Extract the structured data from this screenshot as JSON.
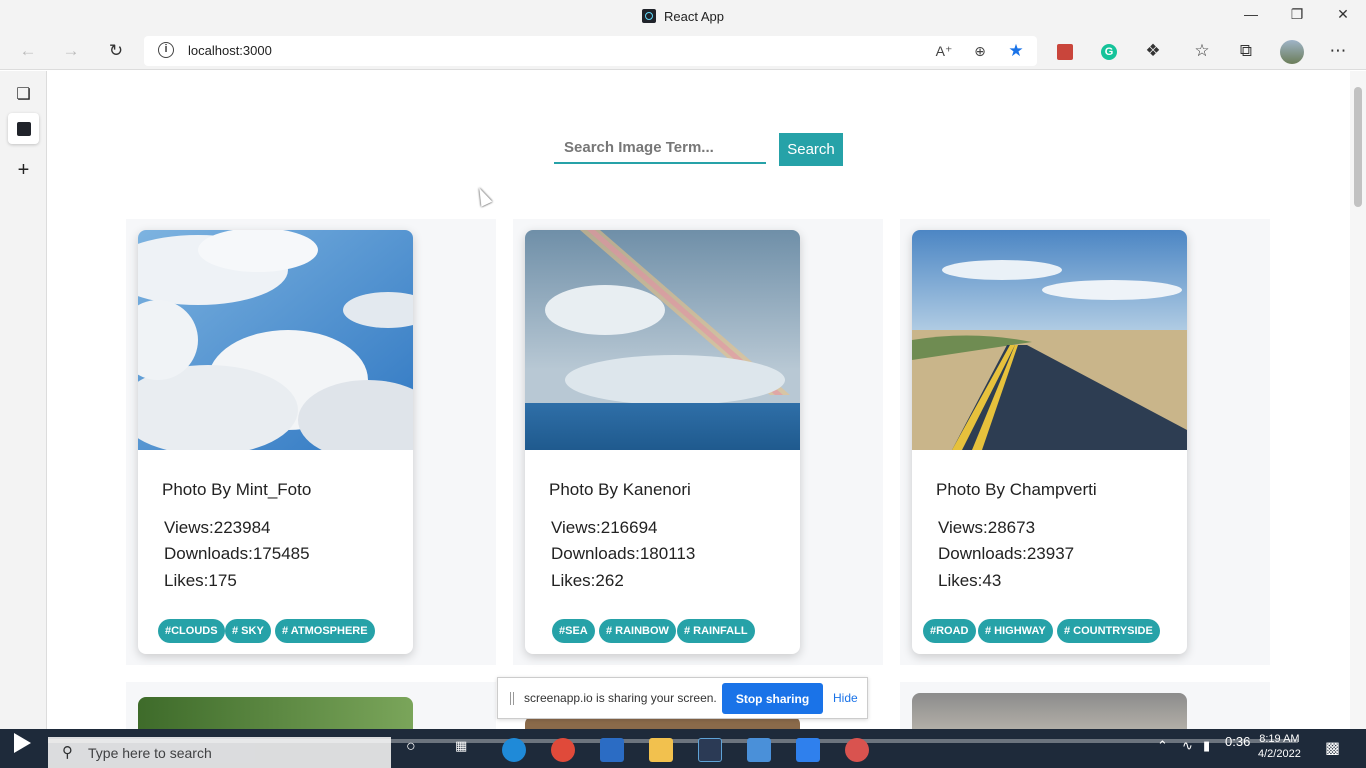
{
  "window": {
    "title": "React App"
  },
  "toolbar": {
    "url": "localhost:3000"
  },
  "search": {
    "placeholder": "Search Image Term...",
    "button_label": "Search"
  },
  "cards": [
    {
      "author": "Photo By Mint_Foto",
      "views_label": "Views:",
      "views": "223984",
      "downloads_label": "Downloads:",
      "downloads": "175485",
      "likes_label": "Likes:",
      "likes": "175",
      "tags": [
        "#CLOUDS",
        "# SKY",
        "# ATMOSPHERE"
      ]
    },
    {
      "author": "Photo By Kanenori",
      "views_label": "Views:",
      "views": "216694",
      "downloads_label": "Downloads:",
      "downloads": "180113",
      "likes_label": "Likes:",
      "likes": "262",
      "tags": [
        "#SEA",
        "# RAINBOW",
        "# RAINFALL"
      ]
    },
    {
      "author": "Photo By Champverti",
      "views_label": "Views:",
      "views": "28673",
      "downloads_label": "Downloads:",
      "downloads": "23937",
      "likes_label": "Likes:",
      "likes": "43",
      "tags": [
        "#ROAD",
        "# HIGHWAY",
        "# COUNTRYSIDE"
      ]
    }
  ],
  "sharebar": {
    "text": "screenapp.io is sharing your screen.",
    "stop_label": "Stop sharing",
    "hide_label": "Hide"
  },
  "taskbar": {
    "search_placeholder": "Type here to search",
    "elapsed": "0:36",
    "time": "8:19 AM",
    "date": "4/2/2022",
    "progress": 0.04
  },
  "colors": {
    "accent": "#26a2a8",
    "share_blue": "#1a73e8"
  }
}
